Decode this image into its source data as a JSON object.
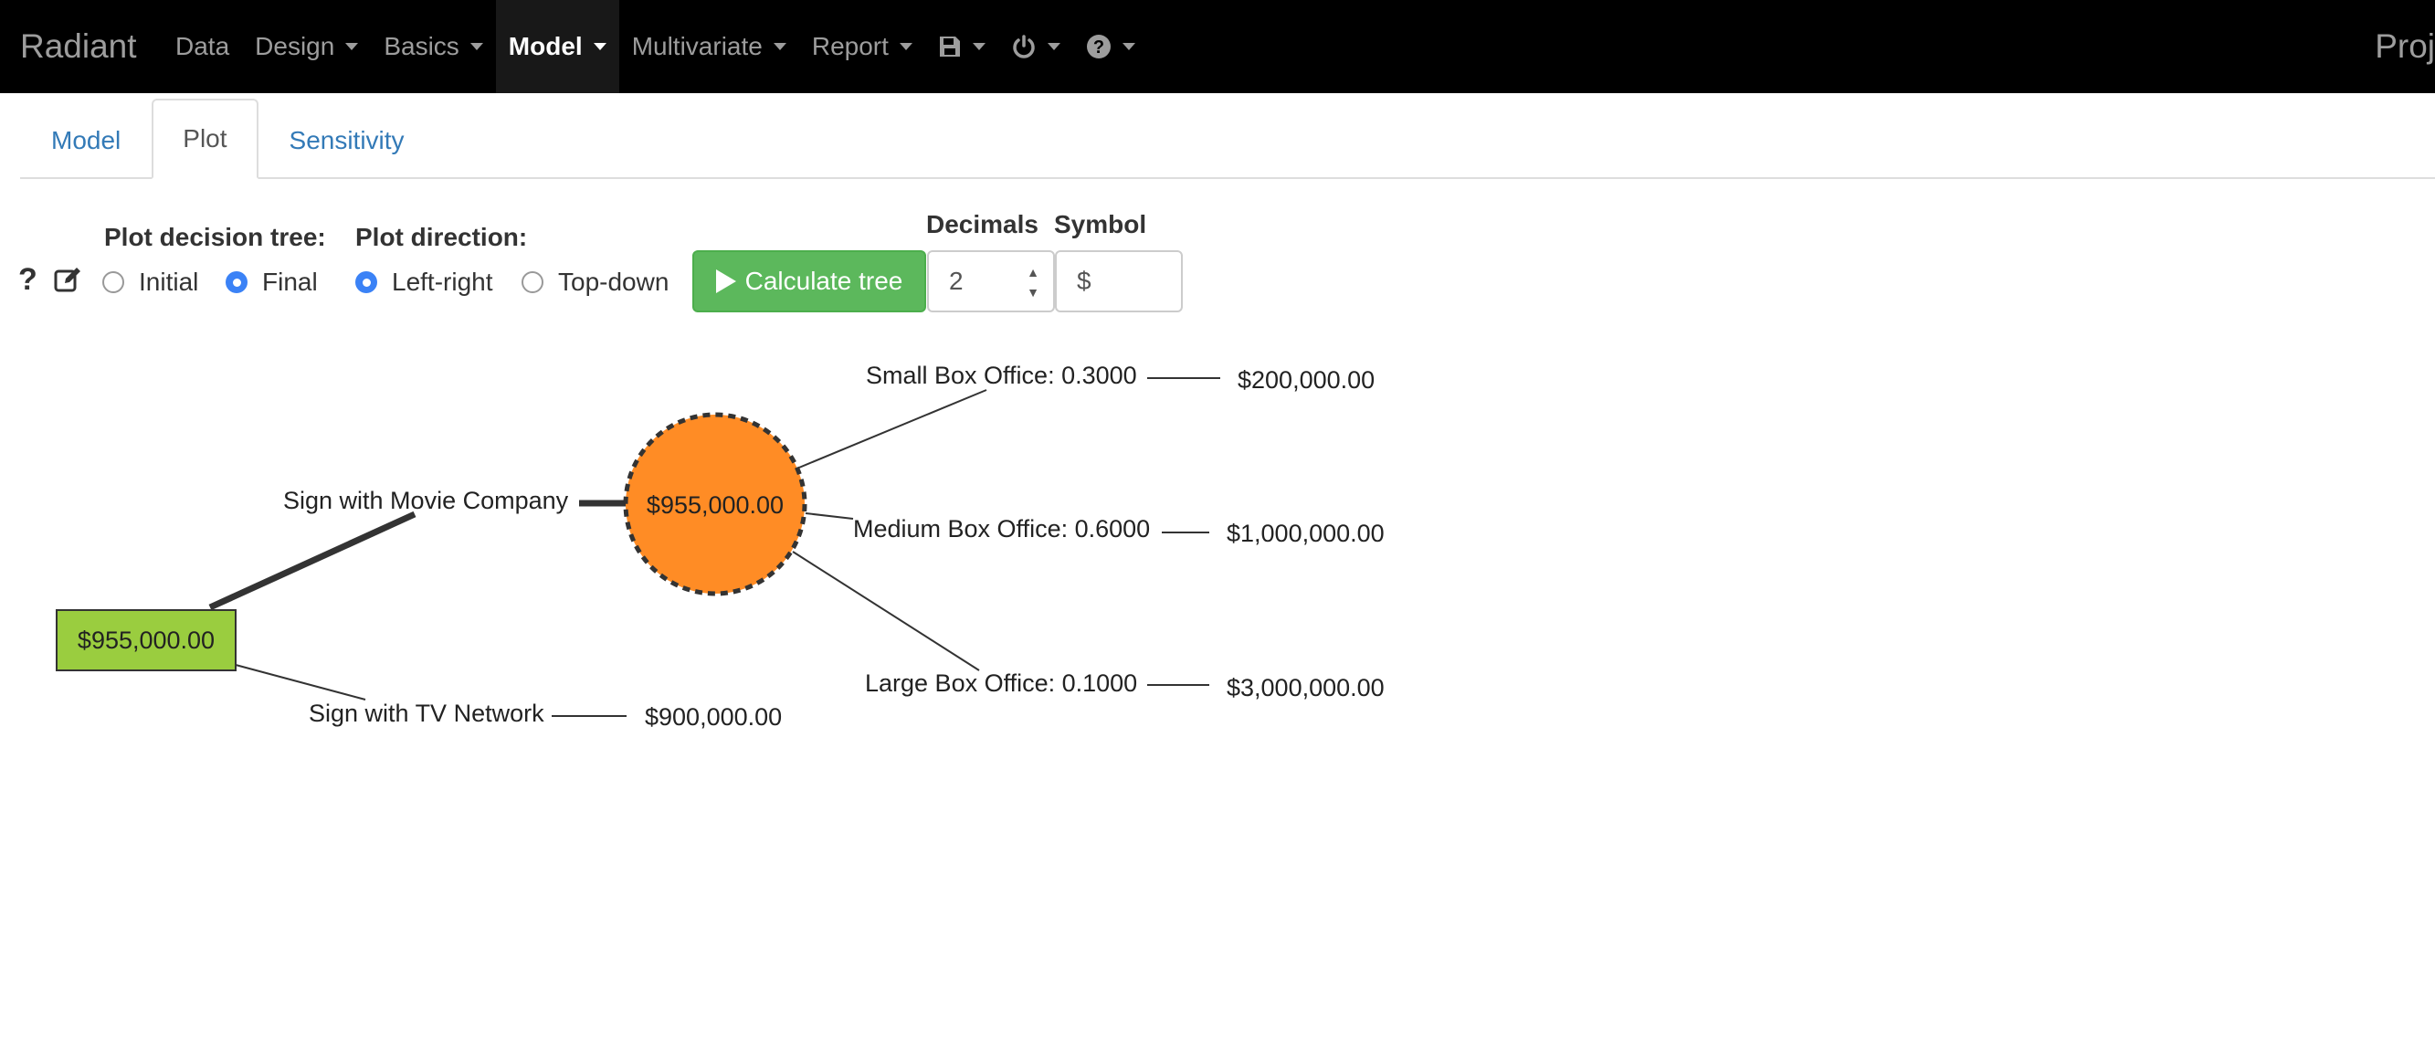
{
  "nav": {
    "brand": "Radiant",
    "items": [
      {
        "label": "Data",
        "caret": false,
        "active": false
      },
      {
        "label": "Design",
        "caret": true,
        "active": false
      },
      {
        "label": "Basics",
        "caret": true,
        "active": false
      },
      {
        "label": "Model",
        "caret": true,
        "active": true
      },
      {
        "label": "Multivariate",
        "caret": true,
        "active": false
      },
      {
        "label": "Report",
        "caret": true,
        "active": false
      }
    ],
    "icons": [
      "save-icon",
      "power-icon",
      "help-icon"
    ],
    "right_label": "Proj"
  },
  "tabs": [
    {
      "label": "Model",
      "active": false
    },
    {
      "label": "Plot",
      "active": true
    },
    {
      "label": "Sensitivity",
      "active": false
    }
  ],
  "controls": {
    "help_glyph": "?",
    "plot_tree_label": "Plot decision tree:",
    "plot_tree_options": [
      "Initial",
      "Final"
    ],
    "plot_tree_selected": "Final",
    "direction_label": "Plot direction:",
    "direction_options": [
      "Left-right",
      "Top-down"
    ],
    "direction_selected": "Left-right",
    "calc_button": "Calculate tree",
    "decimals_label": "Decimals",
    "decimals_value": "2",
    "symbol_label": "Symbol",
    "symbol_value": "$"
  },
  "tree": {
    "root_value": "$955,000.00",
    "branch_top": "Sign with Movie Company",
    "branch_bottom": "Sign with TV Network",
    "chance_value": "$955,000.00",
    "tv_payoff": "$900,000.00",
    "outcomes": [
      {
        "label": "Small Box Office: 0.3000",
        "payoff": "$200,000.00"
      },
      {
        "label": "Medium Box Office: 0.6000",
        "payoff": "$1,000,000.00"
      },
      {
        "label": "Large Box Office: 0.1000",
        "payoff": "$3,000,000.00"
      }
    ],
    "colors": {
      "decision": "#9acd3f",
      "chance": "#ff8c25",
      "line": "#333333"
    }
  }
}
